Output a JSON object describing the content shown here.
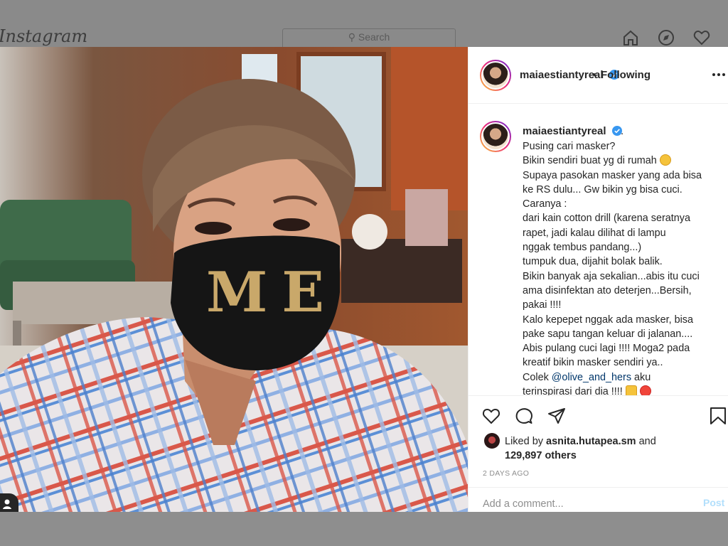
{
  "topbar": {
    "logo": "Instagram",
    "search_placeholder": "Search",
    "nav_icons": [
      "home-icon",
      "explore-icon",
      "heart-icon"
    ]
  },
  "post": {
    "username": "maiaestiantyreal",
    "verified": true,
    "separator": "•",
    "follow_status": "Following",
    "more_icon": "more-dots-icon",
    "photo_description_text": "ME"
  },
  "caption": {
    "username": "maiaestiantyreal",
    "suffix": ".",
    "lines": [
      "Pusing cari masker?",
      "Bikin sendiri buat yg di rumah",
      "Supaya pasokan masker yang ada bisa",
      "ke RS dulu... Gw bikin yg bisa cuci.",
      "Caranya :",
      "dari kain cotton drill (karena seratnya",
      "rapet, jadi kalau dilihat di lampu",
      "nggak tembus pandang...)",
      "tumpuk dua, dijahit bolak balik.",
      "Bikin banyak aja sekalian...abis itu cuci",
      "ama disinfektan ato deterjen...Bersih,",
      "pakai !!!!",
      "Kalo kepepet nggak ada masker, bisa",
      "pake sapu tangan keluar di jalanan....",
      "Abis pulang cuci lagi !!!! Moga2 pada",
      "kreatif bikin masker sendiri ya..",
      "Colek",
      "terinspirasi dari dia !!!!"
    ],
    "mention": "@olive_and_hers",
    "mention_after": "aku"
  },
  "actions": {
    "icons": [
      "heart-icon",
      "comment-icon",
      "share-icon",
      "bookmark-icon"
    ],
    "liked_by_prefix": "Liked by",
    "liked_by_user": "asnita.hutapea.sm",
    "liked_by_and": "and",
    "others_count": "129,897 others",
    "timestamp": "2 DAYS AGO",
    "comment_placeholder": "Add a comment...",
    "post_label": "Post"
  },
  "colors": {
    "verified_blue": "#3897f0",
    "mention_blue": "#00376b",
    "post_button_disabled": "#b2dffc",
    "overlay_gray": "#8e8e8e"
  }
}
